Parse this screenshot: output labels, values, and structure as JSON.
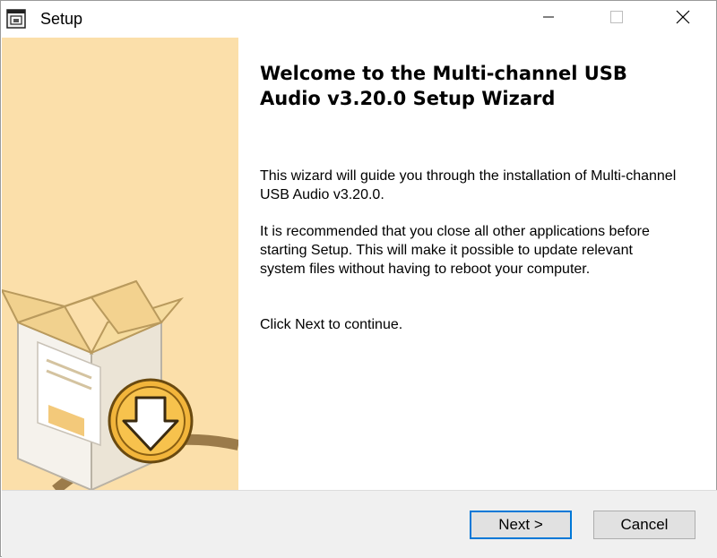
{
  "window": {
    "title": "Setup",
    "icon": "setup-app-icon"
  },
  "controls": {
    "minimize_icon": "minimize-icon",
    "maximize_icon": "maximize-icon",
    "close_icon": "close-icon"
  },
  "content": {
    "heading": "Welcome to the Multi-channel USB Audio v3.20.0 Setup Wizard",
    "paragraph1": "This wizard will guide you through the installation of Multi-channel USB Audio v3.20.0.",
    "paragraph2": "It is recommended that you close all other applications before starting Setup. This will make it possible to update relevant system files without having to reboot your computer.",
    "paragraph3": "Click Next to continue."
  },
  "buttons": {
    "next_label": "Next >",
    "cancel_label": "Cancel"
  },
  "colors": {
    "banner": "#fbdfaa",
    "accent": "#0078d7",
    "bottom_bar": "#f0f0f0"
  }
}
